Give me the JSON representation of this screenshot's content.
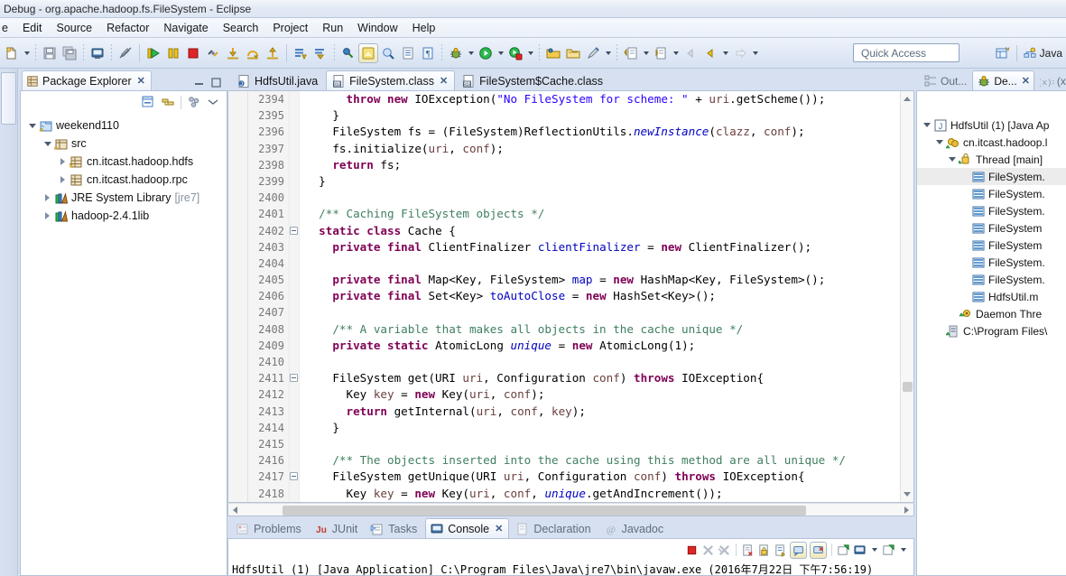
{
  "window": {
    "title": "Debug - org.apache.hadoop.fs.FileSystem - Eclipse"
  },
  "menu": {
    "items": [
      "e",
      "Edit",
      "Source",
      "Refactor",
      "Navigate",
      "Search",
      "Project",
      "Run",
      "Window",
      "Help"
    ]
  },
  "toolbar": {
    "quick_access_placeholder": "Quick Access",
    "perspective_label": "Java",
    "buttons": [
      {
        "name": "new-wizard-icon",
        "glyph": "new"
      },
      {
        "name": "new-dropdown-arrow",
        "glyph": "arrow"
      },
      {
        "name": "save-icon",
        "glyph": "save"
      },
      {
        "name": "save-all-icon",
        "glyph": "saveall"
      },
      {
        "name": "print-icon",
        "glyph": "print"
      },
      {
        "name": "toggle-mark-occurrences-icon",
        "glyph": "pencil-strike"
      },
      {
        "name": "resume-icon",
        "glyph": "resume"
      },
      {
        "name": "suspend-icon",
        "glyph": "suspend"
      },
      {
        "name": "terminate-icon",
        "glyph": "terminate"
      },
      {
        "name": "disconnect-icon",
        "glyph": "disconnect"
      },
      {
        "name": "step-into-icon",
        "glyph": "step-into"
      },
      {
        "name": "step-over-icon",
        "glyph": "step-over"
      },
      {
        "name": "step-return-icon",
        "glyph": "step-return"
      },
      {
        "name": "drop-to-frame-icon",
        "glyph": "drop-frame"
      },
      {
        "name": "use-step-filters-icon",
        "glyph": "filters"
      },
      {
        "name": "skip-breakpoints-icon",
        "glyph": "skip-bp"
      },
      {
        "name": "pin-console-icon",
        "glyph": "pin"
      },
      {
        "name": "open-type-icon",
        "glyph": "opentype"
      },
      {
        "name": "open-task-icon",
        "glyph": "opentask"
      },
      {
        "name": "toggle-breadcrumb-icon",
        "glyph": "breadcrumb"
      },
      {
        "name": "debug-run-icon",
        "glyph": "debug-bug"
      },
      {
        "name": "run-icon",
        "glyph": "run-green"
      },
      {
        "name": "external-tools-icon",
        "glyph": "ext-tools"
      },
      {
        "name": "open-resource-icon",
        "glyph": "folder1"
      },
      {
        "name": "search-folder-icon",
        "glyph": "folder2"
      },
      {
        "name": "new-java-project-icon",
        "glyph": "brush"
      },
      {
        "name": "next-annotation-icon",
        "glyph": "annot-next"
      },
      {
        "name": "previous-annotation-icon",
        "glyph": "annot-prev"
      },
      {
        "name": "back-icon",
        "glyph": "back-gray"
      },
      {
        "name": "backward-history-icon",
        "glyph": "back-yellow"
      },
      {
        "name": "forward-history-icon",
        "glyph": "fwd-gray"
      }
    ]
  },
  "package_explorer": {
    "tab_label": "Package Explorer",
    "tree": [
      {
        "label": "weekend110",
        "icon": "java-project-icon",
        "indent": 0,
        "twist": "open",
        "sub": ""
      },
      {
        "label": "src",
        "icon": "source-folder-icon",
        "indent": 1,
        "twist": "open",
        "sub": ""
      },
      {
        "label": "cn.itcast.hadoop.hdfs",
        "icon": "package-warn-icon",
        "indent": 2,
        "twist": "closed",
        "sub": ""
      },
      {
        "label": "cn.itcast.hadoop.rpc",
        "icon": "package-icon",
        "indent": 2,
        "twist": "closed",
        "sub": ""
      },
      {
        "label": "JRE System Library",
        "icon": "library-icon",
        "indent": 1,
        "twist": "closed",
        "sub": "[jre7]"
      },
      {
        "label": "hadoop-2.4.1lib",
        "icon": "library-icon",
        "indent": 1,
        "twist": "closed",
        "sub": ""
      }
    ]
  },
  "editor": {
    "tabs": [
      {
        "label": "HdfsUtil.java",
        "icon": "java-file-icon",
        "active": false,
        "closable": false
      },
      {
        "label": "FileSystem.class",
        "icon": "class-file-icon",
        "active": true,
        "closable": true
      },
      {
        "label": "FileSystem$Cache.class",
        "icon": "class-file-icon",
        "active": false,
        "closable": false
      }
    ],
    "first_line": 2394,
    "lines": [
      {
        "n": 2394,
        "fold": false,
        "bp": false,
        "text": "      throw new IOException(\"No FileSystem for scheme: \" + uri.getScheme());"
      },
      {
        "n": 2395,
        "fold": false,
        "bp": false,
        "text": "    }"
      },
      {
        "n": 2396,
        "fold": false,
        "bp": false,
        "text": "    FileSystem fs = (FileSystem)ReflectionUtils.newInstance(clazz, conf);"
      },
      {
        "n": 2397,
        "fold": false,
        "bp": false,
        "text": "    fs.initialize(uri, conf);"
      },
      {
        "n": 2398,
        "fold": false,
        "bp": false,
        "text": "    return fs;"
      },
      {
        "n": 2399,
        "fold": false,
        "bp": false,
        "text": "  }"
      },
      {
        "n": 2400,
        "fold": false,
        "bp": false,
        "text": ""
      },
      {
        "n": 2401,
        "fold": false,
        "bp": false,
        "text": "  /** Caching FileSystem objects */"
      },
      {
        "n": 2402,
        "fold": true,
        "bp": false,
        "text": "  static class Cache {"
      },
      {
        "n": 2403,
        "fold": false,
        "bp": false,
        "text": "    private final ClientFinalizer clientFinalizer = new ClientFinalizer();"
      },
      {
        "n": 2404,
        "fold": false,
        "bp": false,
        "text": ""
      },
      {
        "n": 2405,
        "fold": false,
        "bp": false,
        "text": "    private final Map<Key, FileSystem> map = new HashMap<Key, FileSystem>();"
      },
      {
        "n": 2406,
        "fold": false,
        "bp": false,
        "text": "    private final Set<Key> toAutoClose = new HashSet<Key>();"
      },
      {
        "n": 2407,
        "fold": false,
        "bp": false,
        "text": ""
      },
      {
        "n": 2408,
        "fold": false,
        "bp": false,
        "text": "    /** A variable that makes all objects in the cache unique */"
      },
      {
        "n": 2409,
        "fold": false,
        "bp": false,
        "text": "    private static AtomicLong unique = new AtomicLong(1);"
      },
      {
        "n": 2410,
        "fold": false,
        "bp": false,
        "text": ""
      },
      {
        "n": 2411,
        "fold": true,
        "bp": false,
        "text": "    FileSystem get(URI uri, Configuration conf) throws IOException{"
      },
      {
        "n": 2412,
        "fold": false,
        "bp": true,
        "text": "      Key key = new Key(uri, conf);"
      },
      {
        "n": 2413,
        "fold": false,
        "bp": false,
        "text": "      return getInternal(uri, conf, key);"
      },
      {
        "n": 2414,
        "fold": false,
        "bp": false,
        "text": "    }"
      },
      {
        "n": 2415,
        "fold": false,
        "bp": false,
        "text": ""
      },
      {
        "n": 2416,
        "fold": false,
        "bp": false,
        "text": "    /** The objects inserted into the cache using this method are all unique */"
      },
      {
        "n": 2417,
        "fold": true,
        "bp": false,
        "text": "    FileSystem getUnique(URI uri, Configuration conf) throws IOException{"
      },
      {
        "n": 2418,
        "fold": false,
        "bp": false,
        "text": "      Key key = new Key(uri, conf, unique.getAndIncrement());"
      }
    ]
  },
  "console": {
    "tabs": [
      {
        "label": "Problems",
        "icon": "problems-icon",
        "active": false,
        "closable": false
      },
      {
        "label": "JUnit",
        "icon": "junit-icon",
        "active": false,
        "closable": false
      },
      {
        "label": "Tasks",
        "icon": "tasks-icon",
        "active": false,
        "closable": false
      },
      {
        "label": "Console",
        "icon": "console-icon",
        "active": true,
        "closable": true
      },
      {
        "label": "Declaration",
        "icon": "declaration-icon",
        "active": false,
        "closable": false
      },
      {
        "label": "Javadoc",
        "icon": "javadoc-icon",
        "active": false,
        "closable": false
      }
    ],
    "toolbar_buttons": [
      {
        "name": "terminate-console-button",
        "glyph": "terminate"
      },
      {
        "name": "remove-launch-button",
        "glyph": "x-gray"
      },
      {
        "name": "remove-all-launches-button",
        "glyph": "xx-gray"
      },
      {
        "name": "clear-console-button",
        "glyph": "clear"
      },
      {
        "name": "scroll-lock-button",
        "glyph": "lock"
      },
      {
        "name": "word-wrap-button",
        "glyph": "wrap"
      },
      {
        "name": "show-console-output-button",
        "glyph": "console-out"
      },
      {
        "name": "show-console-error-button",
        "glyph": "console-err"
      },
      {
        "name": "pin-console-button",
        "glyph": "pin-green"
      },
      {
        "name": "display-selected-console-button",
        "glyph": "display-console"
      },
      {
        "name": "display-console-dropdown",
        "glyph": "arrow"
      },
      {
        "name": "open-console-button",
        "glyph": "open-console"
      },
      {
        "name": "open-console-dropdown",
        "glyph": "arrow"
      }
    ],
    "output": "HdfsUtil (1) [Java Application] C:\\Program Files\\Java\\jre7\\bin\\javaw.exe (2016年7月22日 下午7:56:19)"
  },
  "right_panel": {
    "tabs": [
      {
        "label": "Out...",
        "icon": "outline-icon",
        "active": false,
        "closable": false
      },
      {
        "label": "De...",
        "icon": "debug-icon",
        "active": true,
        "closable": true
      },
      {
        "label": "(x)=",
        "icon": "variables-icon",
        "active": false,
        "closable": false
      }
    ],
    "tree": [
      {
        "label": "HdfsUtil (1) [Java Ap",
        "icon": "launch-config-icon",
        "indent": 0,
        "twist": "open",
        "selected": false
      },
      {
        "label": "cn.itcast.hadoop.l",
        "icon": "debug-target-icon",
        "indent": 1,
        "twist": "open",
        "selected": false
      },
      {
        "label": "Thread [main]",
        "icon": "thread-icon",
        "indent": 2,
        "twist": "open",
        "selected": false
      },
      {
        "label": "FileSystem.",
        "icon": "stack-frame-icon",
        "indent": 3,
        "twist": "none",
        "selected": true
      },
      {
        "label": "FileSystem.",
        "icon": "stack-frame-icon",
        "indent": 3,
        "twist": "none",
        "selected": false
      },
      {
        "label": "FileSystem.",
        "icon": "stack-frame-icon",
        "indent": 3,
        "twist": "none",
        "selected": false
      },
      {
        "label": "FileSystem",
        "icon": "stack-frame-icon",
        "indent": 3,
        "twist": "none",
        "selected": false
      },
      {
        "label": "FileSystem",
        "icon": "stack-frame-icon",
        "indent": 3,
        "twist": "none",
        "selected": false
      },
      {
        "label": "FileSystem.",
        "icon": "stack-frame-icon",
        "indent": 3,
        "twist": "none",
        "selected": false
      },
      {
        "label": "FileSystem.",
        "icon": "stack-frame-icon",
        "indent": 3,
        "twist": "none",
        "selected": false
      },
      {
        "label": "HdfsUtil.m",
        "icon": "stack-frame-icon",
        "indent": 3,
        "twist": "none",
        "selected": false
      },
      {
        "label": "Daemon Thre",
        "icon": "daemon-thread-icon",
        "indent": 2,
        "twist": "none",
        "selected": false
      },
      {
        "label": "C:\\Program Files\\",
        "icon": "process-icon",
        "indent": 1,
        "twist": "none",
        "selected": false
      }
    ]
  },
  "colors": {
    "keyword": "#7f0055",
    "string": "#2a00ff",
    "comment": "#3f7f5f",
    "field": "#0000c0",
    "parameter": "#6a3e3e",
    "chrome": "#d6e0f0",
    "accent": "#3b5b87"
  }
}
